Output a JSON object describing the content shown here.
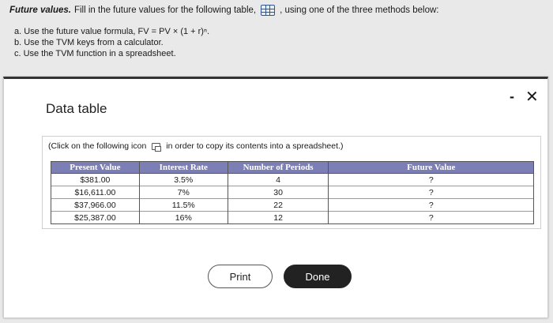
{
  "question": {
    "title": "Future values.",
    "instruction": "Fill in the future values for the following table,",
    "instruction_tail": ", using one of the three methods below:",
    "methods": [
      "a.  Use the future value formula, FV = PV × (1 + r)ⁿ.",
      "b.  Use the TVM keys from a calculator.",
      "c.  Use the TVM function in a spreadsheet."
    ]
  },
  "modal": {
    "title": "Data table",
    "minimize": "-",
    "close": "✕",
    "note_before": "(Click on the following icon",
    "note_after": "in order to copy its contents into a spreadsheet.)",
    "print_label": "Print",
    "done_label": "Done"
  },
  "table": {
    "headers": [
      "Present Value",
      "Interest Rate",
      "Number of Periods",
      "Future Value"
    ],
    "rows": [
      [
        "$381.00",
        "3.5%",
        "4",
        "?"
      ],
      [
        "$16,611.00",
        "7%",
        "30",
        "?"
      ],
      [
        "$37,966.00",
        "11.5%",
        "22",
        "?"
      ],
      [
        "$25,387.00",
        "16%",
        "12",
        "?"
      ]
    ]
  },
  "colors": {
    "header_bg": "#7b7fb5",
    "done_bg": "#222222"
  }
}
